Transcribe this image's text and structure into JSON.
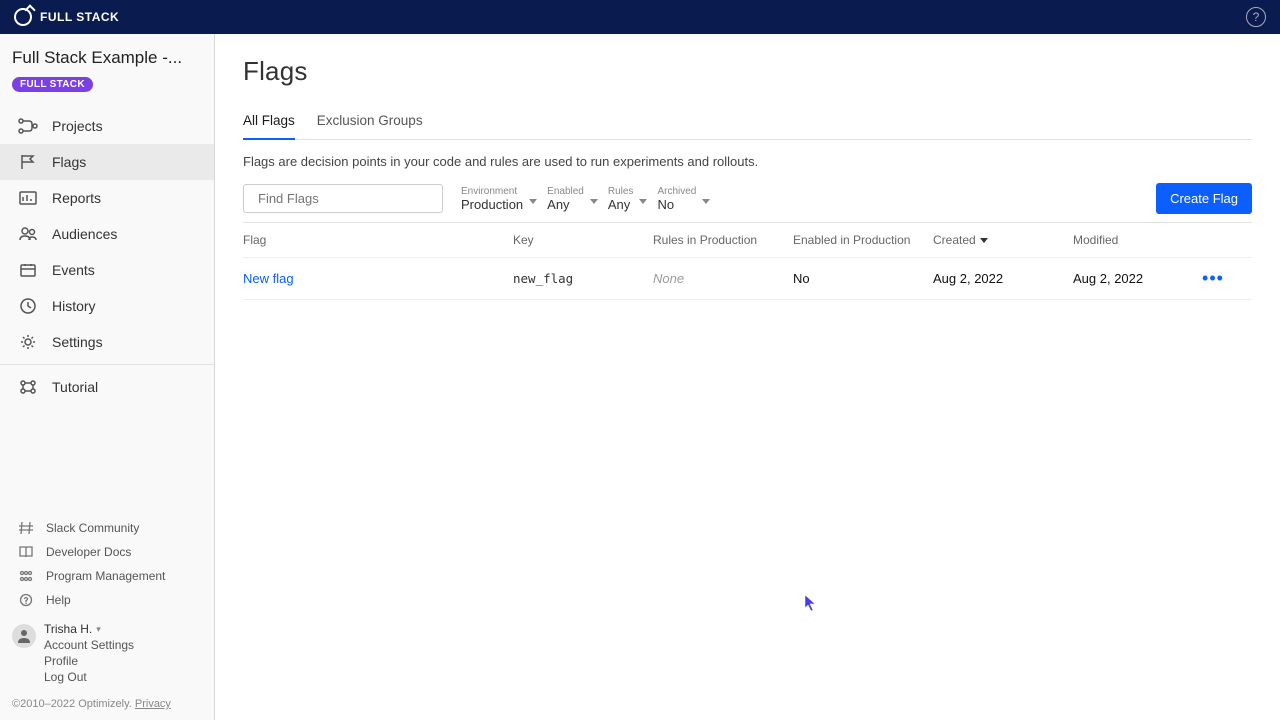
{
  "topbar": {
    "brand": "FULL STACK"
  },
  "sidebar": {
    "project_name": "Full Stack Example -...",
    "project_badge": "FULL STACK",
    "nav": {
      "projects": "Projects",
      "flags": "Flags",
      "reports": "Reports",
      "audiences": "Audiences",
      "events": "Events",
      "history": "History",
      "settings": "Settings",
      "tutorial": "Tutorial"
    },
    "bottom_links": {
      "slack": "Slack Community",
      "docs": "Developer Docs",
      "program": "Program Management",
      "help": "Help"
    },
    "user": {
      "name": "Trisha H.",
      "account_settings": "Account Settings",
      "profile": "Profile",
      "logout": "Log Out"
    },
    "copyright": "©2010–2022 Optimizely.",
    "privacy": "Privacy"
  },
  "main": {
    "title": "Flags",
    "tabs": {
      "all_flags": "All Flags",
      "exclusion_groups": "Exclusion Groups"
    },
    "description": "Flags are decision points in your code and rules are used to run experiments and rollouts.",
    "search_placeholder": "Find Flags",
    "filters": {
      "environment": {
        "label": "Environment",
        "value": "Production"
      },
      "enabled": {
        "label": "Enabled",
        "value": "Any"
      },
      "rules": {
        "label": "Rules",
        "value": "Any"
      },
      "archived": {
        "label": "Archived",
        "value": "No"
      }
    },
    "create_button": "Create Flag",
    "columns": {
      "flag": "Flag",
      "key": "Key",
      "rules_in_production": "Rules in Production",
      "enabled_in_production": "Enabled in Production",
      "created": "Created",
      "modified": "Modified"
    },
    "rows": [
      {
        "flag": "New flag",
        "key": "new_flag",
        "rules": "None",
        "enabled": "No",
        "created": "Aug 2, 2022",
        "modified": "Aug 2, 2022"
      }
    ]
  }
}
